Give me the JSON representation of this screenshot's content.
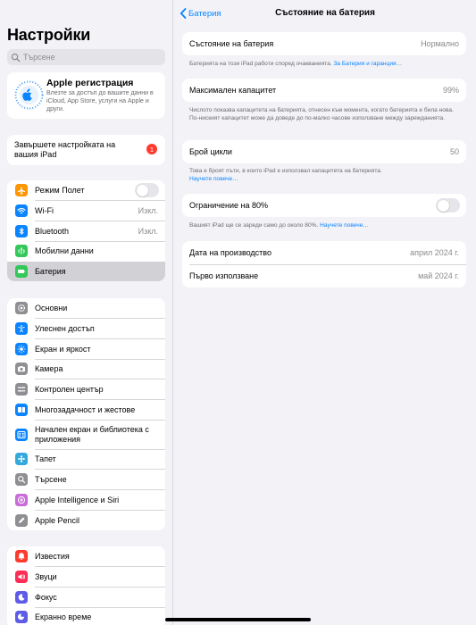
{
  "sidebar": {
    "title": "Настройки",
    "search_placeholder": "Търсене",
    "apple": {
      "title": "Apple регистрация",
      "subtitle": "Влезте за достъп до вашите данни в iCloud, App Store, услуги на Apple и други."
    },
    "setup": {
      "label": "Завършете настройката на вашия iPad",
      "badge": "1"
    },
    "group1": [
      {
        "label": "Режим Полет",
        "icon": "airplane-icon",
        "color": "#ff9500",
        "toggle": true
      },
      {
        "label": "Wi-Fi",
        "icon": "wifi-icon",
        "color": "#0a84ff",
        "value": "Изкл."
      },
      {
        "label": "Bluetooth",
        "icon": "bluetooth-icon",
        "color": "#0a84ff",
        "value": "Изкл."
      },
      {
        "label": "Мобилни данни",
        "icon": "cellular-icon",
        "color": "#34c759"
      },
      {
        "label": "Батерия",
        "icon": "battery-icon",
        "color": "#34c759",
        "selected": true
      }
    ],
    "group2": [
      {
        "label": "Основни",
        "icon": "gear-icon",
        "color": "#8e8e93"
      },
      {
        "label": "Улеснен достъп",
        "icon": "accessibility-icon",
        "color": "#0a84ff"
      },
      {
        "label": "Екран и яркост",
        "icon": "brightness-icon",
        "color": "#0a84ff"
      },
      {
        "label": "Камера",
        "icon": "camera-icon",
        "color": "#8e8e93"
      },
      {
        "label": "Контролен център",
        "icon": "control-center-icon",
        "color": "#8e8e93"
      },
      {
        "label": "Многозадачност и жестове",
        "icon": "multitasking-icon",
        "color": "#0a84ff"
      },
      {
        "label": "Начален екран и библиотека с приложения",
        "icon": "home-screen-icon",
        "color": "#0a84ff",
        "tall": true
      },
      {
        "label": "Тапет",
        "icon": "wallpaper-icon",
        "color": "#34aadc"
      },
      {
        "label": "Търсене",
        "icon": "search-icon",
        "color": "#8e8e93"
      },
      {
        "label": "Apple Intelligence и Siri",
        "icon": "siri-icon",
        "color": "#c86dd7"
      },
      {
        "label": "Apple Pencil",
        "icon": "pencil-icon",
        "color": "#8e8e93"
      }
    ],
    "group3": [
      {
        "label": "Известия",
        "icon": "notifications-icon",
        "color": "#ff3b30"
      },
      {
        "label": "Звуци",
        "icon": "sound-icon",
        "color": "#ff2d55"
      },
      {
        "label": "Фокус",
        "icon": "focus-moon-icon",
        "color": "#5e5ce6"
      },
      {
        "label": "Екранно време",
        "icon": "screen-time-icon",
        "color": "#5e5ce6"
      }
    ]
  },
  "main": {
    "back_label": "Батерия",
    "title": "Състояние на батерия",
    "health": {
      "label": "Състояние на батерия",
      "value": "Нормално"
    },
    "health_note": "Батерията на този iPad работи според очакванията.",
    "health_link": "За Батерия и гаранция…",
    "capacity": {
      "label": "Максимален капацитет",
      "value": "99%"
    },
    "capacity_note": "Числото показва капацитета на батерията, отнесен към момента, когато батерията е била нова. По-ниският капацитет може да доведе до по-малко часове използване между зарежданията.",
    "cycles": {
      "label": "Брой цикли",
      "value": "50"
    },
    "cycles_note": "Това е броят пъти, в които iPad е използвал капацитета на батерията.",
    "cycles_link": "Научете повече…",
    "limit": {
      "label": "Ограничение на 80%"
    },
    "limit_note": "Вашият iPad ще се зареди само до около 80%.",
    "limit_link": "Научете повече…",
    "manufacture": {
      "label": "Дата на производство",
      "value": "април 2024 г."
    },
    "first_use": {
      "label": "Първо използване",
      "value": "май 2024 г."
    }
  }
}
